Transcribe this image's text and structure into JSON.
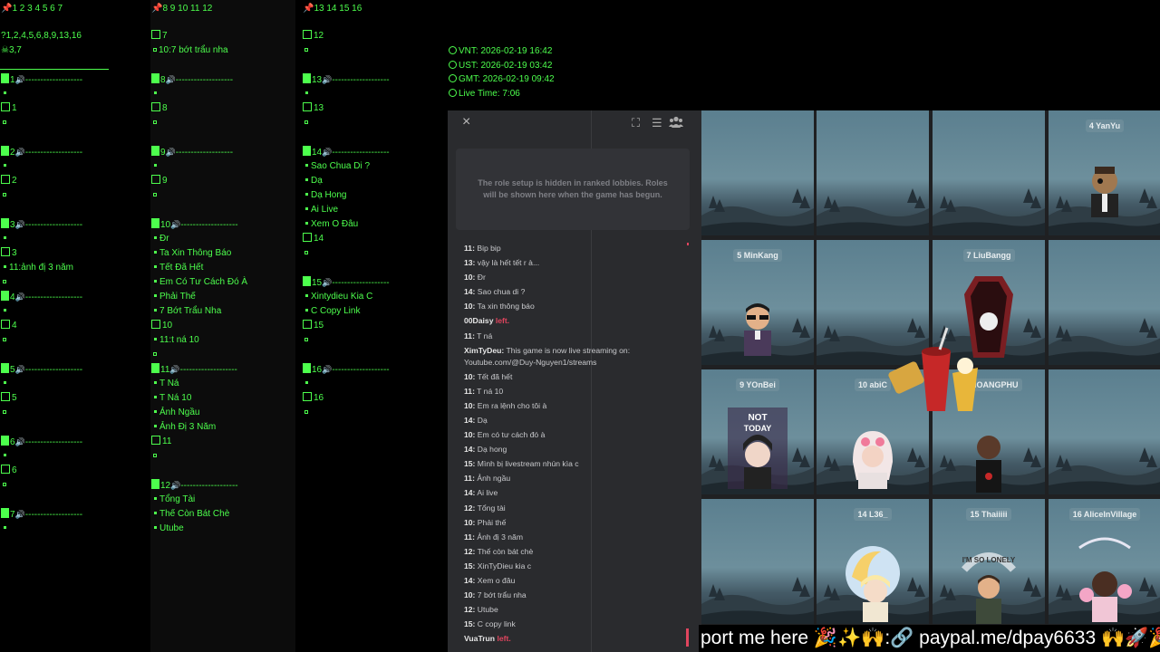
{
  "columns": [
    {
      "header": "1 2 3 4 5 6 7",
      "info": [
        "1,2,4,5,6,8,9,13,16",
        "3,7"
      ],
      "slots": [
        {
          "num": "1",
          "lines": [
            "1"
          ]
        },
        {
          "num": "2",
          "lines": [
            "2"
          ]
        },
        {
          "num": "3",
          "lines": [
            "3",
            "11:ảnh đị 3 năm"
          ]
        },
        {
          "num": "4",
          "lines": [
            "4"
          ]
        },
        {
          "num": "5",
          "lines": [
            "5"
          ]
        },
        {
          "num": "6",
          "lines": [
            "6"
          ]
        },
        {
          "num": "7",
          "lines": []
        }
      ]
    },
    {
      "header": "8 9 10 11 12",
      "info": [
        "7",
        "10:7 bớt trẩu nha"
      ],
      "slots": [
        {
          "num": "8",
          "lines": [
            "8"
          ]
        },
        {
          "num": "9",
          "lines": [
            "9"
          ]
        },
        {
          "num": "10",
          "lines": [
            "Đr",
            "Ta Xin Thông Báo",
            "Tết Đã Hết",
            "Em Có Tư Cách Đó À",
            "Phải Thế",
            "7 Bớt Trẩu Nha",
            "10",
            "11:t ná 10"
          ]
        },
        {
          "num": "11",
          "lines": [
            "T Ná",
            "T Ná 10",
            "Ảnh Ngầu",
            "Ảnh Đị 3 Năm",
            "11"
          ]
        },
        {
          "num": "12",
          "lines": [
            "Tổng Tài",
            "Thế Còn Bát Chè",
            "Utube"
          ]
        }
      ]
    },
    {
      "header": "13 14 15 16",
      "info": [
        "12"
      ],
      "slots": [
        {
          "num": "13",
          "lines": [
            "13"
          ]
        },
        {
          "num": "14",
          "lines": [
            "Sao Chua Di ?",
            "Dạ",
            "Dạ Hong",
            "Ai Live",
            "Xem O Đâu",
            "14"
          ]
        },
        {
          "num": "15",
          "lines": [
            "Xintydieu Kia C",
            "C Copy Link",
            "15"
          ]
        },
        {
          "num": "16",
          "lines": [
            "16"
          ]
        }
      ]
    }
  ],
  "clocks": [
    "VNT: 2026-02-19 16:42",
    "UST: 2026-02-19 03:42",
    "GMT: 2026-02-19 09:42",
    "Live Time: 7:06"
  ],
  "panel": {
    "close_icon": "×",
    "role_notice": "The role setup is hidden in ranked lobbies. Roles will be shown here when the game has begun.",
    "chat": [
      {
        "who": "11:",
        "text": " Bip bip"
      },
      {
        "who": "13:",
        "text": " vậy là hết tết r à..."
      },
      {
        "who": "10:",
        "text": " Đr"
      },
      {
        "who": "14:",
        "text": " Sao chua di ?"
      },
      {
        "who": "10:",
        "text": " Ta xin thông báo"
      },
      {
        "who": "00Daisy",
        "left": " left."
      },
      {
        "who": "11:",
        "text": " T ná"
      },
      {
        "who": "XimTyDeu:",
        "text": " This game is now live streaming on: Youtube.com/@Duy-Nguyen1/streams",
        "wrap": true
      },
      {
        "who": "10:",
        "text": " Tết đã hết"
      },
      {
        "who": "11:",
        "text": " T ná 10"
      },
      {
        "who": "10:",
        "text": " Em ra lệnh cho tôi à"
      },
      {
        "who": "14:",
        "text": " Dạ"
      },
      {
        "who": "10:",
        "text": " Em có tư cách đó à"
      },
      {
        "who": "14:",
        "text": " Dạ hong"
      },
      {
        "who": "15:",
        "text": " Mình bị livestream nhún kìa c"
      },
      {
        "who": "11:",
        "text": " Ảnh ngầu"
      },
      {
        "who": "14:",
        "text": " Ai live"
      },
      {
        "who": "12:",
        "text": " Tổng tài"
      },
      {
        "who": "10:",
        "text": " Phải thế"
      },
      {
        "who": "11:",
        "text": " Ảnh đị 3 năm"
      },
      {
        "who": "12:",
        "text": " Thế còn bát chè"
      },
      {
        "who": "15:",
        "text": " XinTyDieu kia c"
      },
      {
        "who": "14:",
        "text": " Xem o đâu"
      },
      {
        "who": "10:",
        "text": " 7 bớt trẩu nha"
      },
      {
        "who": "12:",
        "text": " Utube"
      },
      {
        "who": "15:",
        "text": " C copy link"
      },
      {
        "who": "VuaTrun",
        "left": " left."
      }
    ]
  },
  "players": [
    {
      "label": "",
      "avatar": ""
    },
    {
      "label": "",
      "avatar": ""
    },
    {
      "label": "",
      "avatar": ""
    },
    {
      "label": "4 YanYu",
      "avatar": "skull-avatar"
    },
    {
      "label": "5 MinKang",
      "avatar": "sunglasses-avatar"
    },
    {
      "label": "",
      "avatar": ""
    },
    {
      "label": "7 LiuBangg",
      "avatar": "coffin-avatar"
    },
    {
      "label": "",
      "avatar": ""
    },
    {
      "label": "9 YOnBei",
      "avatar": "not-today-avatar"
    },
    {
      "label": "10 abiC",
      "avatar": "pink-hair-avatar"
    },
    {
      "label": "VUHOANGPHU",
      "avatar": "bald-avatar"
    },
    {
      "label": "",
      "avatar": ""
    },
    {
      "label": "",
      "avatar": ""
    },
    {
      "label": "14 L36_",
      "avatar": "moon-avatar"
    },
    {
      "label": "15 Thaiiiii",
      "avatar": "lonely-avatar"
    },
    {
      "label": "16 AliceInVillage",
      "avatar": "flower-avatar"
    }
  ],
  "ticker": "port me here 🎉✨🙌:🔗 paypal.me/dpay6633 🙌🚀🎉",
  "colors": {
    "overlay_green": "#4dff4d",
    "panel_bg": "#2a2b2e",
    "left_red": "#e0455e"
  }
}
